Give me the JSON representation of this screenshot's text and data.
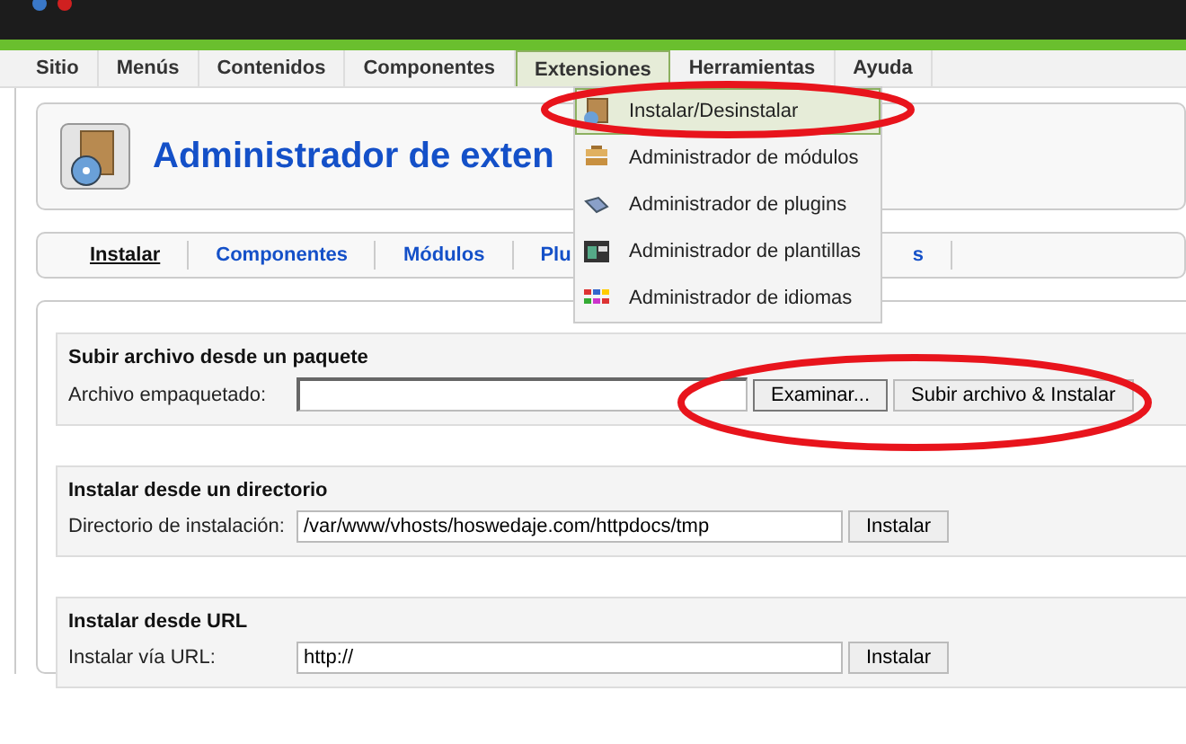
{
  "menu_bar": [
    {
      "label": "Sitio",
      "selected": false
    },
    {
      "label": "Menús",
      "selected": false
    },
    {
      "label": "Contenidos",
      "selected": false
    },
    {
      "label": "Componentes",
      "selected": false
    },
    {
      "label": "Extensiones",
      "selected": true
    },
    {
      "label": "Herramientas",
      "selected": false
    },
    {
      "label": "Ayuda",
      "selected": false
    }
  ],
  "dropdown": [
    {
      "label": "Instalar/Desinstalar",
      "kind": "install",
      "selected": true
    },
    {
      "label": "Administrador de módulos",
      "kind": "modules",
      "selected": false
    },
    {
      "label": "Administrador de plugins",
      "kind": "plugins",
      "selected": false
    },
    {
      "label": "Administrador de plantillas",
      "kind": "templates",
      "selected": false
    },
    {
      "label": "Administrador de idiomas",
      "kind": "languages",
      "selected": false
    }
  ],
  "page_title": "Administrador de exten",
  "tabs": [
    {
      "label": "Instalar",
      "selected": true
    },
    {
      "label": "Componentes",
      "selected": false
    },
    {
      "label": "Módulos",
      "selected": false
    },
    {
      "label": "Plu",
      "selected": false
    },
    {
      "label": "s",
      "selected": false
    }
  ],
  "sections": [
    {
      "title": "Subir archivo desde un paquete",
      "kind": "upload",
      "label": "Archivo empaquetado:",
      "buttons": [
        "Examinar...",
        "Subir archivo & Instalar"
      ]
    },
    {
      "title": "Instalar desde un directorio",
      "kind": "text",
      "label": "Directorio de instalación:",
      "value": "/var/www/vhosts/hoswedaje.com/httpdocs/tmp",
      "buttons": [
        "Instalar"
      ]
    },
    {
      "title": "Instalar desde URL",
      "kind": "text",
      "label": "Instalar vía URL:",
      "value": "http://",
      "buttons": [
        "Instalar"
      ]
    }
  ]
}
